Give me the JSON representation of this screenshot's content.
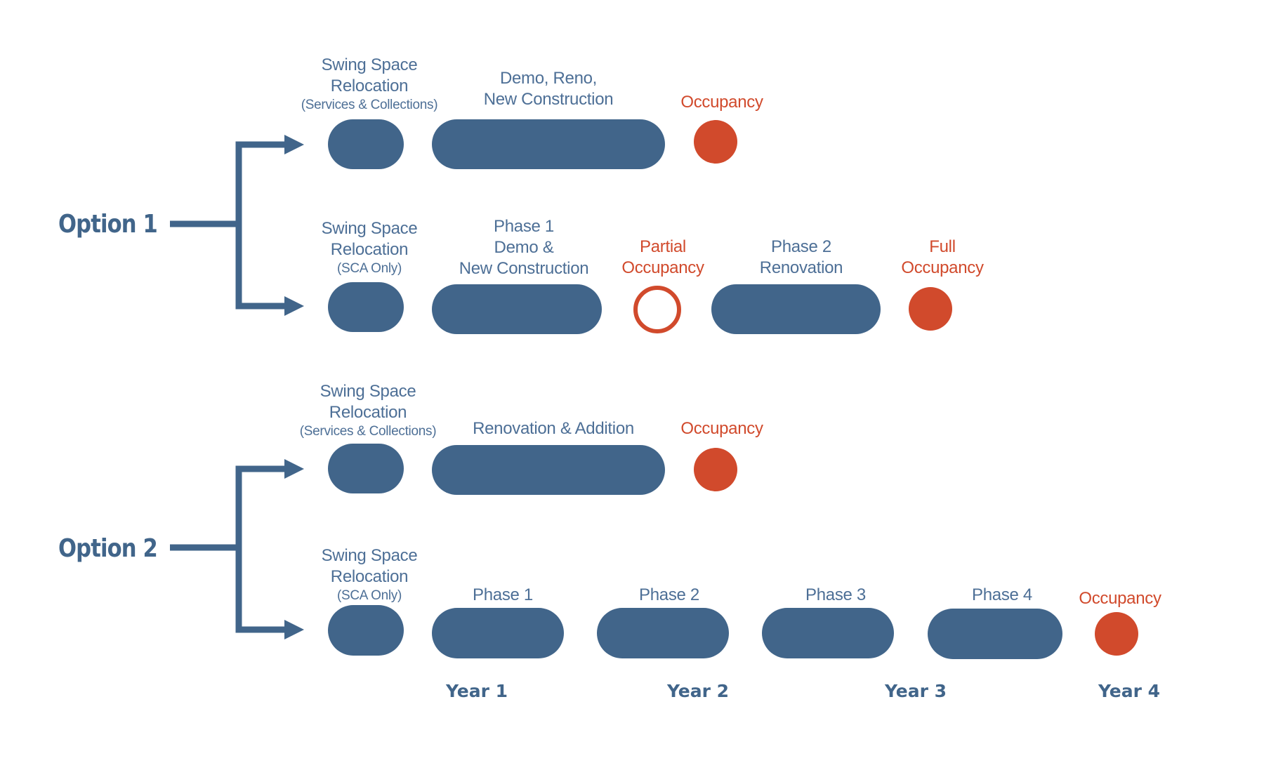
{
  "colors": {
    "primary": "#41658a",
    "accent": "#d14a2c",
    "label": "#4d6f96"
  },
  "options": [
    {
      "label": "Option 1",
      "tracks": [
        {
          "steps": [
            {
              "type": "pill",
              "label_lines": [
                "Swing Space",
                "Relocation"
              ],
              "sublabel": "(Services & Collections)"
            },
            {
              "type": "pill",
              "label_lines": [
                "Demo, Reno,",
                "New Construction"
              ]
            },
            {
              "type": "milestone-filled",
              "label_lines": [
                "Occupancy"
              ]
            }
          ]
        },
        {
          "steps": [
            {
              "type": "pill",
              "label_lines": [
                "Swing Space",
                "Relocation"
              ],
              "sublabel": "(SCA Only)"
            },
            {
              "type": "pill",
              "label_lines": [
                "Phase 1",
                "Demo &",
                "New Construction"
              ]
            },
            {
              "type": "milestone-hollow",
              "label_lines": [
                "Partial",
                "Occupancy"
              ]
            },
            {
              "type": "pill",
              "label_lines": [
                "Phase 2",
                "Renovation"
              ]
            },
            {
              "type": "milestone-filled",
              "label_lines": [
                "Full",
                "Occupancy"
              ]
            }
          ]
        }
      ]
    },
    {
      "label": "Option 2",
      "tracks": [
        {
          "steps": [
            {
              "type": "pill",
              "label_lines": [
                "Swing Space",
                "Relocation"
              ],
              "sublabel": "(Services & Collections)"
            },
            {
              "type": "pill",
              "label_lines": [
                "Renovation & Addition"
              ]
            },
            {
              "type": "milestone-filled",
              "label_lines": [
                "Occupancy"
              ]
            }
          ]
        },
        {
          "steps": [
            {
              "type": "pill",
              "label_lines": [
                "Swing Space",
                "Relocation"
              ],
              "sublabel": "(SCA Only)"
            },
            {
              "type": "pill",
              "label_lines": [
                "Phase 1"
              ]
            },
            {
              "type": "pill",
              "label_lines": [
                "Phase 2"
              ]
            },
            {
              "type": "pill",
              "label_lines": [
                "Phase 3"
              ]
            },
            {
              "type": "pill",
              "label_lines": [
                "Phase 4"
              ]
            },
            {
              "type": "milestone-filled",
              "label_lines": [
                "Occupancy"
              ]
            }
          ]
        }
      ]
    }
  ],
  "timeline": {
    "years": [
      "Year 1",
      "Year 2",
      "Year 3",
      "Year 4"
    ]
  }
}
